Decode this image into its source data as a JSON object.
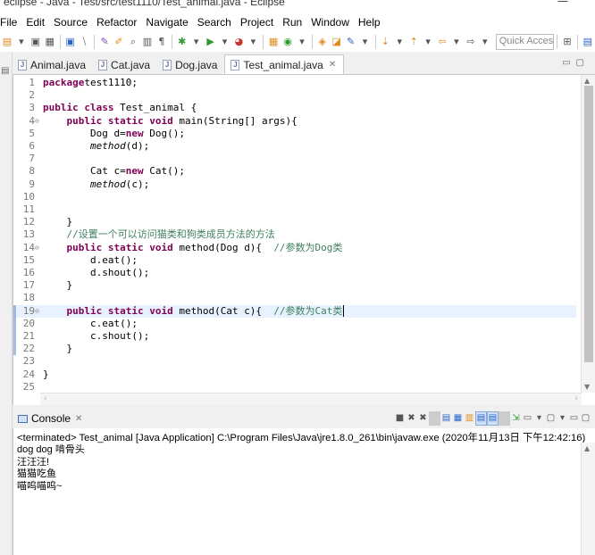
{
  "window": {
    "title": "eclipse - Java - Test/src/test1110/Test_animal.java - Eclipse",
    "minimize_glyph": "—"
  },
  "menu": [
    "File",
    "Edit",
    "Source",
    "Refactor",
    "Navigate",
    "Search",
    "Project",
    "Run",
    "Window",
    "Help"
  ],
  "toolbar": {
    "icons": [
      "new-icon",
      "save-icon",
      "save-all-icon",
      "print-icon",
      "terminal-icon",
      "skip-breakpoints-icon",
      "open-type-icon",
      "edit-icon",
      "search-icon",
      "toggle-mark-icon",
      "show-whitespace-icon",
      "debug-icon",
      "run-icon",
      "coverage-icon",
      "new-java-project-icon",
      "new-package-icon",
      "new-class-icon",
      "open-task-icon",
      "annotation-icon",
      "next-edit-icon",
      "back-icon",
      "forward-icon"
    ],
    "quick_access_placeholder": "Quick Access"
  },
  "editor": {
    "tabs": [
      {
        "label": "Animal.java",
        "active": false
      },
      {
        "label": "Cat.java",
        "active": false
      },
      {
        "label": "Dog.java",
        "active": false
      },
      {
        "label": "Test_animal.java",
        "active": true
      }
    ],
    "close_glyph": "✕",
    "lines": [
      {
        "n": "1",
        "fold": "",
        "parts": [
          [
            "kw",
            "package"
          ],
          [
            "",
            "test1110;"
          ]
        ]
      },
      {
        "n": "2",
        "fold": "",
        "parts": []
      },
      {
        "n": "3",
        "fold": "",
        "parts": [
          [
            "kw",
            "public class"
          ],
          [
            "",
            " Test_animal {"
          ]
        ]
      },
      {
        "n": "4",
        "fold": "⊖",
        "parts": [
          [
            "",
            "    "
          ],
          [
            "kw",
            "public static void"
          ],
          [
            "",
            " main(String[] args){"
          ]
        ]
      },
      {
        "n": "5",
        "fold": "",
        "parts": [
          [
            "",
            "        Dog d="
          ],
          [
            "kw",
            "new"
          ],
          [
            "",
            " Dog();"
          ]
        ]
      },
      {
        "n": "6",
        "fold": "",
        "parts": [
          [
            "",
            "        "
          ],
          [
            "it",
            "method"
          ],
          [
            "",
            "(d);"
          ]
        ]
      },
      {
        "n": "7",
        "fold": "",
        "parts": []
      },
      {
        "n": "8",
        "fold": "",
        "parts": [
          [
            "",
            "        Cat c="
          ],
          [
            "kw",
            "new"
          ],
          [
            "",
            " Cat();"
          ]
        ]
      },
      {
        "n": "9",
        "fold": "",
        "parts": [
          [
            "",
            "        "
          ],
          [
            "it",
            "method"
          ],
          [
            "",
            "(c);"
          ]
        ]
      },
      {
        "n": "10",
        "fold": "",
        "parts": []
      },
      {
        "n": "11",
        "fold": "",
        "parts": []
      },
      {
        "n": "12",
        "fold": "",
        "parts": [
          [
            "",
            "    }"
          ]
        ]
      },
      {
        "n": "13",
        "fold": "",
        "parts": [
          [
            "cm",
            "    //设置一个可以访问猫类和狗类成员方法的方法"
          ]
        ]
      },
      {
        "n": "14",
        "fold": "⊖",
        "parts": [
          [
            "",
            "    "
          ],
          [
            "kw",
            "public static void"
          ],
          [
            "",
            " method(Dog d){  "
          ],
          [
            "cm",
            "//参数为Dog类"
          ]
        ]
      },
      {
        "n": "15",
        "fold": "",
        "parts": [
          [
            "",
            "        d.eat();"
          ]
        ]
      },
      {
        "n": "16",
        "fold": "",
        "parts": [
          [
            "",
            "        d.shout();"
          ]
        ]
      },
      {
        "n": "17",
        "fold": "",
        "parts": [
          [
            "",
            "    }"
          ]
        ]
      },
      {
        "n": "18",
        "fold": "",
        "parts": []
      },
      {
        "n": "19",
        "fold": "⊖",
        "current": true,
        "changed": true,
        "parts": [
          [
            "",
            "    "
          ],
          [
            "kw",
            "public static void"
          ],
          [
            "",
            " method(Cat c){  "
          ],
          [
            "cm",
            "//参数为Cat类"
          ]
        ]
      },
      {
        "n": "20",
        "fold": "",
        "changed": true,
        "parts": [
          [
            "",
            "        c.eat();"
          ]
        ]
      },
      {
        "n": "21",
        "fold": "",
        "changed": true,
        "parts": [
          [
            "",
            "        c.shout();"
          ]
        ]
      },
      {
        "n": "22",
        "fold": "",
        "changed": true,
        "parts": [
          [
            "",
            "    }"
          ]
        ]
      },
      {
        "n": "23",
        "fold": "",
        "parts": []
      },
      {
        "n": "24",
        "fold": "",
        "parts": [
          [
            "",
            "}"
          ]
        ]
      },
      {
        "n": "25",
        "fold": "",
        "parts": []
      }
    ]
  },
  "console": {
    "tab_label": "Console",
    "close_glyph": "✕",
    "status": "<terminated> Test_animal [Java Application] C:\\Program Files\\Java\\jre1.8.0_261\\bin\\javaw.exe (2020年11月13日 下午12:42:16)",
    "output": [
      "dog dog 啃骨头",
      "汪汪汪!",
      "猫猫吃鱼",
      "喵呜喵呜~"
    ]
  },
  "colors": {
    "keyword": "#7f0055",
    "comment": "#3f7f5f",
    "current_line": "#e8f2fe",
    "line_number": "#787878"
  }
}
